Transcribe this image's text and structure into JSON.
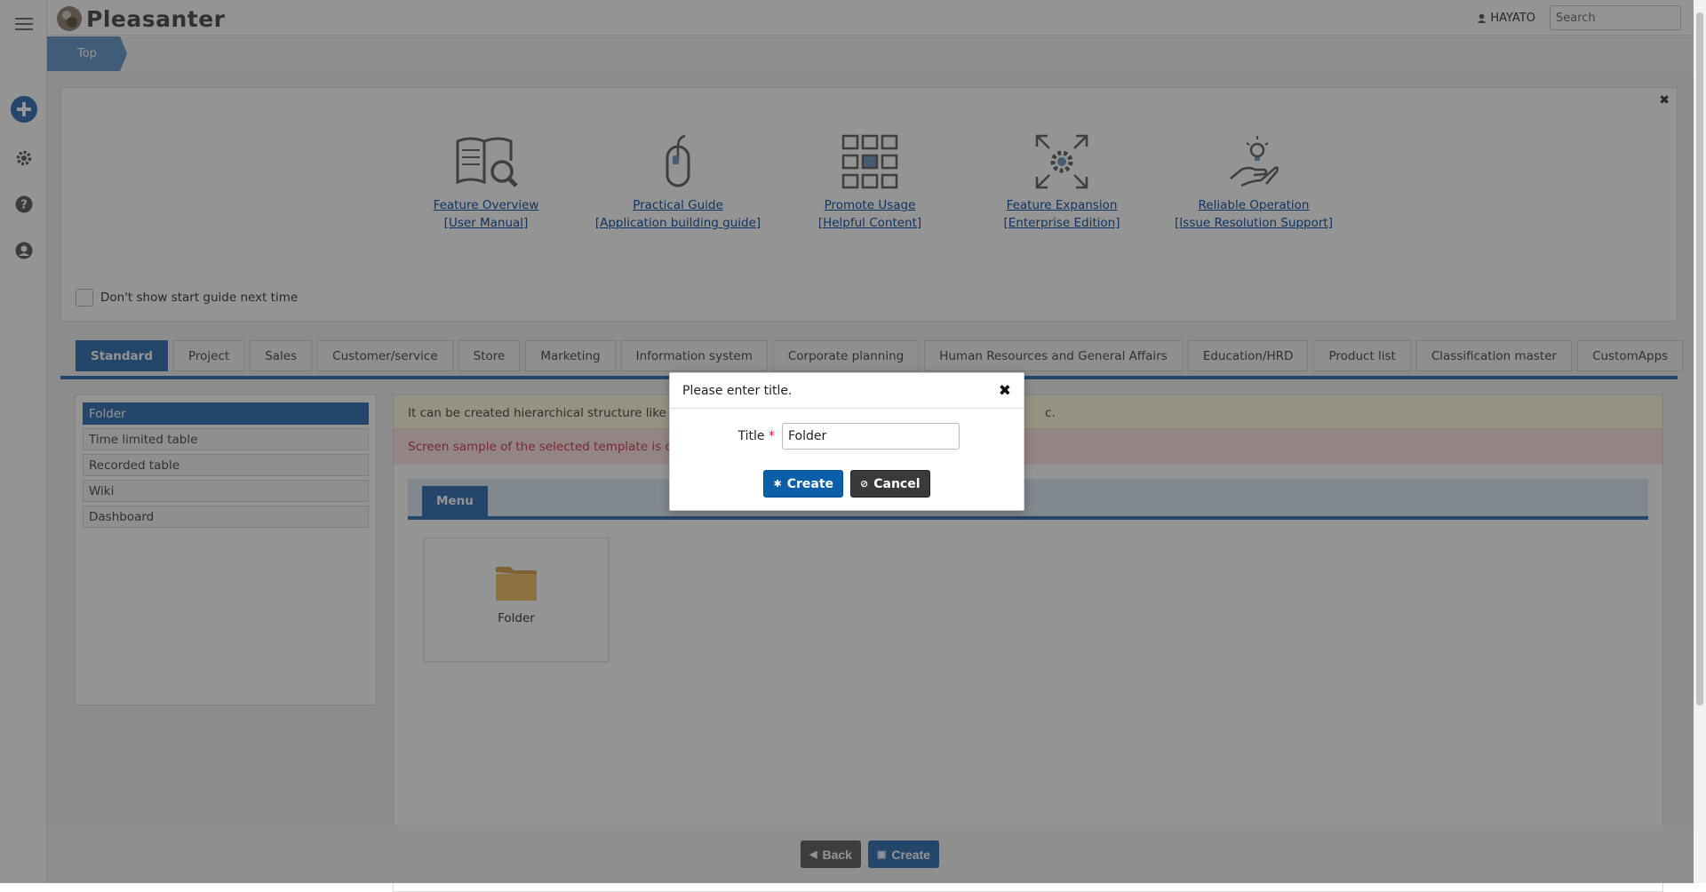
{
  "header": {
    "app_name": "Pleasanter",
    "user_name": "HAYATO",
    "search_placeholder": "Search"
  },
  "breadcrumb": [
    "Top"
  ],
  "left_rail": {
    "icons": [
      "menu-icon",
      "add-icon",
      "gear-icon",
      "help-icon",
      "user-icon"
    ]
  },
  "start_guide": {
    "items": [
      {
        "icon": "manual-icon",
        "line1": "Feature Overview",
        "line2": "[User Manual]"
      },
      {
        "icon": "mouse-icon",
        "line1": "Practical Guide",
        "line2": "[Application building guide]"
      },
      {
        "icon": "content-grid-icon",
        "line1": "Promote Usage",
        "line2": "[Helpful Content]"
      },
      {
        "icon": "expand-gear-icon",
        "line1": "Feature Expansion",
        "line2": "[Enterprise Edition]"
      },
      {
        "icon": "lightbulb-hand-icon",
        "line1": "Reliable Operation",
        "line2": "[Issue Resolution Support]"
      }
    ],
    "dont_show_label": "Don't show start guide next time"
  },
  "tabs": [
    {
      "label": "Standard",
      "active": true
    },
    {
      "label": "Project"
    },
    {
      "label": "Sales"
    },
    {
      "label": "Customer/service"
    },
    {
      "label": "Store"
    },
    {
      "label": "Marketing"
    },
    {
      "label": "Information system"
    },
    {
      "label": "Corporate planning"
    },
    {
      "label": "Human Resources and General Affairs"
    },
    {
      "label": "Education/HRD"
    },
    {
      "label": "Product list"
    },
    {
      "label": "Classification master"
    },
    {
      "label": "CustomApps"
    }
  ],
  "templates": [
    {
      "label": "Folder",
      "active": true
    },
    {
      "label": "Time limited table"
    },
    {
      "label": "Recorded table"
    },
    {
      "label": "Wiki"
    },
    {
      "label": "Dashboard"
    }
  ],
  "detail": {
    "description_prefix": "It can be created hierarchical structure like a f",
    "description_suffix": "c.",
    "sample_note": "Screen sample of the selected template is disp",
    "menu_label": "Menu",
    "folder_label": "Folder"
  },
  "footer": {
    "back_label": "Back",
    "create_label": "Create"
  },
  "dialog": {
    "title": "Please enter title.",
    "field_label": "Title",
    "required_mark": "*",
    "field_value": "Folder",
    "create_label": "Create",
    "cancel_label": "Cancel"
  },
  "colors": {
    "accent": "#3f79b9",
    "primary_button": "#0b5ea8",
    "cancel_button": "#3a3a3a",
    "required": "#d9252f"
  }
}
